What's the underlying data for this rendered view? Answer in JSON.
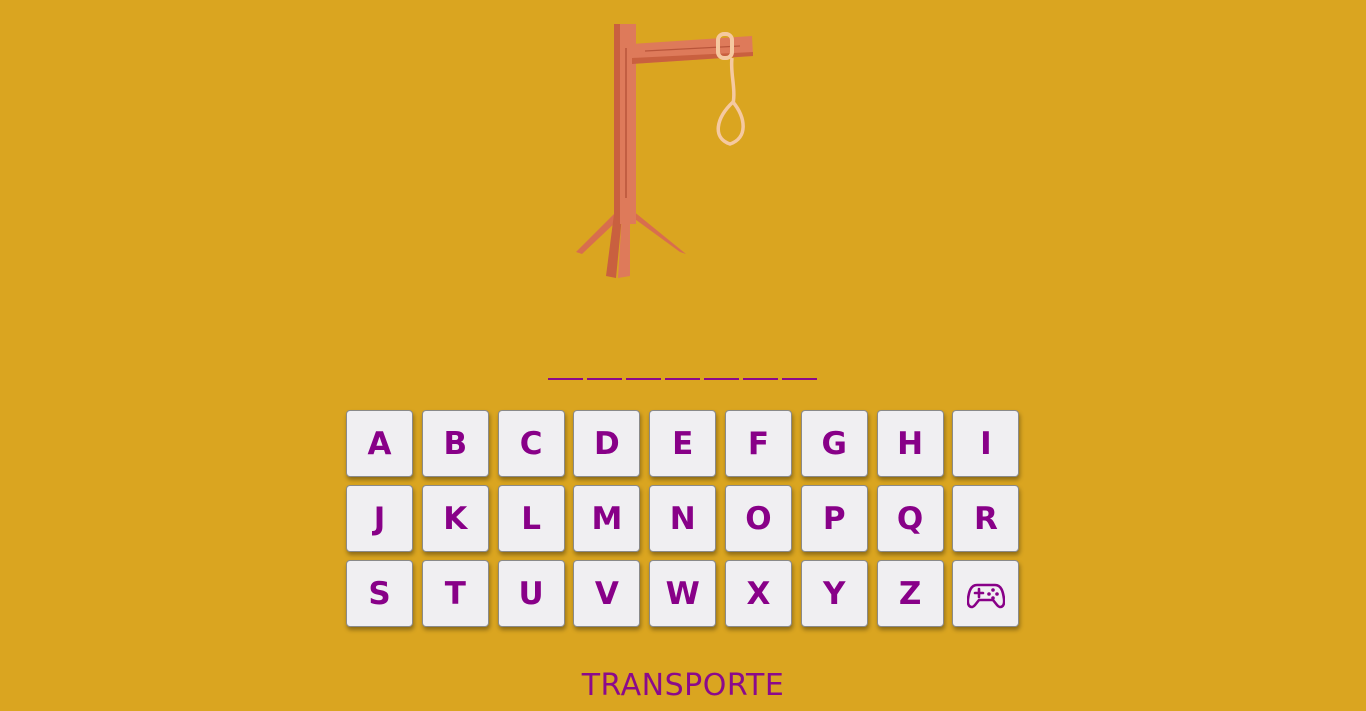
{
  "game": {
    "word_slots": 7,
    "category": "TRANSPORTE"
  },
  "keyboard": {
    "keys": [
      "A",
      "B",
      "C",
      "D",
      "E",
      "F",
      "G",
      "H",
      "I",
      "J",
      "K",
      "L",
      "M",
      "N",
      "O",
      "P",
      "Q",
      "R",
      "S",
      "T",
      "U",
      "V",
      "W",
      "X",
      "Y",
      "Z"
    ],
    "special_icon": "gamepad-icon"
  },
  "colors": {
    "background": "#DAA520",
    "accent": "#880088",
    "key_face": "#F0EFF2",
    "wood": "#DE7A5A",
    "rope": "#F5C9A0"
  }
}
